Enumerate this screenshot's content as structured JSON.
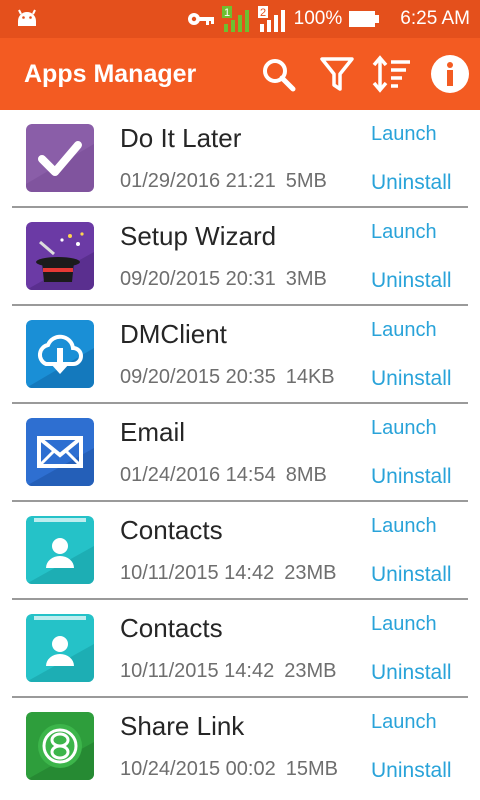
{
  "status_bar": {
    "sim1": "1",
    "sim2": "2",
    "battery_percent": "100%",
    "time": "6:25 AM",
    "icons": [
      "android-icon",
      "key-icon",
      "signal-sim1-icon",
      "signal-sim2-icon",
      "battery-icon"
    ]
  },
  "app_bar": {
    "title": "Apps Manager",
    "actions": [
      "search-icon",
      "filter-icon",
      "sort-icon",
      "info-icon"
    ]
  },
  "apps": [
    {
      "name": "Do It Later",
      "date": "01/29/2016 21:21",
      "size": "5MB",
      "launch": "Launch",
      "uninstall": "Uninstall",
      "icon": "do-it-later-icon"
    },
    {
      "name": "Setup Wizard",
      "date": "09/20/2015 20:31",
      "size": "3MB",
      "launch": "Launch",
      "uninstall": "Uninstall",
      "icon": "setup-wizard-icon"
    },
    {
      "name": "DMClient",
      "date": "09/20/2015 20:35",
      "size": "14KB",
      "launch": "Launch",
      "uninstall": "Uninstall",
      "icon": "dmclient-icon"
    },
    {
      "name": "Email",
      "date": "01/24/2016 14:54",
      "size": "8MB",
      "launch": "Launch",
      "uninstall": "Uninstall",
      "icon": "email-icon"
    },
    {
      "name": "Contacts",
      "date": "10/11/2015 14:42",
      "size": "23MB",
      "launch": "Launch",
      "uninstall": "Uninstall",
      "icon": "contacts-icon"
    },
    {
      "name": "Contacts",
      "date": "10/11/2015 14:42",
      "size": "23MB",
      "launch": "Launch",
      "uninstall": "Uninstall",
      "icon": "contacts-icon"
    },
    {
      "name": "Share Link",
      "date": "10/24/2015 00:02",
      "size": "15MB",
      "launch": "Launch",
      "uninstall": "Uninstall",
      "icon": "share-link-icon"
    }
  ],
  "colors": {
    "status_bar": "#e4501c",
    "app_bar": "#f35b22",
    "link": "#29a3d9",
    "divider": "#9a9a9a"
  }
}
